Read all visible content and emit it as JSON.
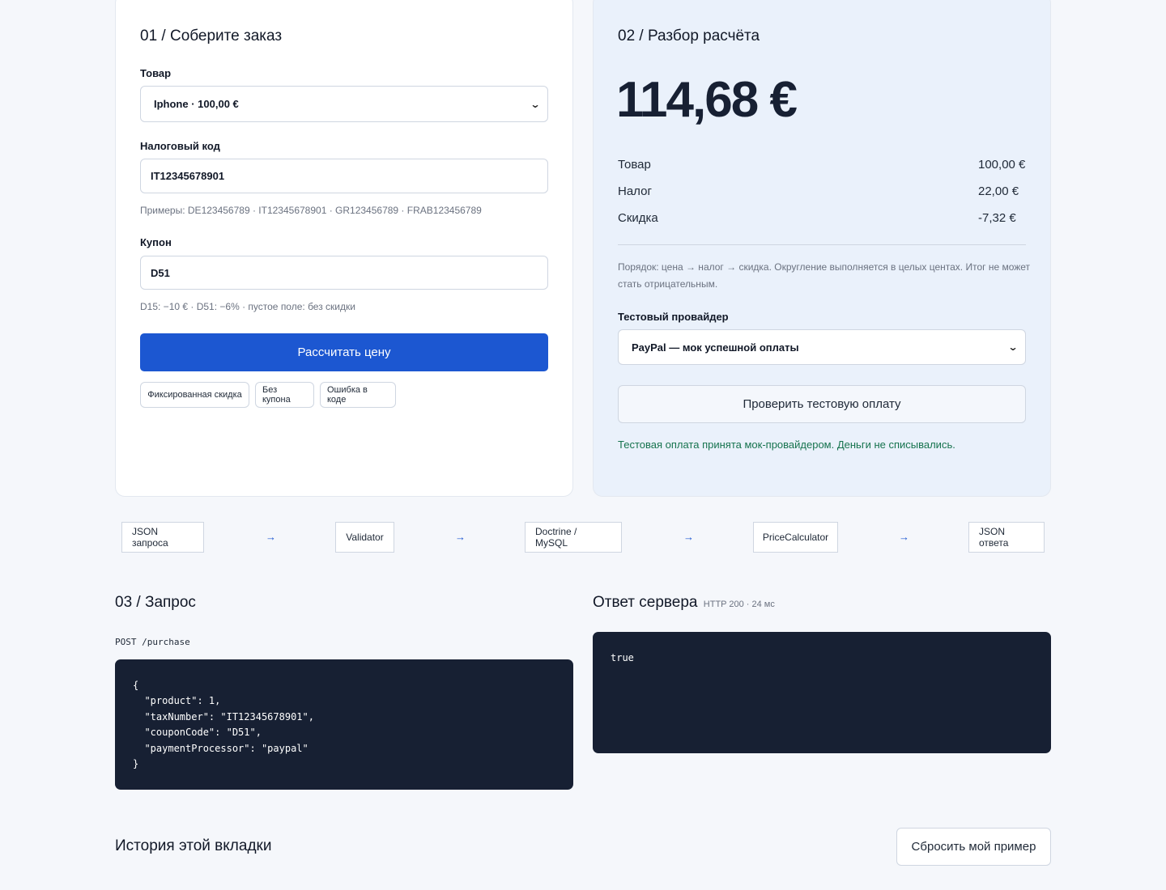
{
  "order": {
    "title": "01 / Соберите заказ",
    "product": {
      "label": "Товар",
      "value": "Iphone · 100,00 €"
    },
    "tax": {
      "label": "Налоговый код",
      "value": "IT12345678901",
      "hint": "Примеры: DE123456789 · IT12345678901 · GR123456789 · FRAB123456789"
    },
    "coupon": {
      "label": "Купон",
      "value": "D51",
      "hint": "D15: −10 € · D51: −6% · пустое поле: без скидки"
    },
    "calculate_label": "Рассчитать цену",
    "presets": [
      "Фиксированная скидка",
      "Без купона",
      "Ошибка в коде"
    ]
  },
  "breakdown": {
    "title": "02 / Разбор расчёта",
    "total": "114,68 €",
    "rows": [
      {
        "label": "Товар",
        "value": "100,00 €"
      },
      {
        "label": "Налог",
        "value": "22,00 €"
      },
      {
        "label": "Скидка",
        "value": "-7,32 €"
      }
    ],
    "note": "Порядок: цена → налог → скидка. Округление выполняется в целых центах. Итог не может стать отрицательным.",
    "provider": {
      "label": "Тестовый провайдер",
      "value": "PayPal — мок успешной оплаты"
    },
    "check_label": "Проверить тестовую оплату",
    "success_message": "Тестовая оплата принята мок-провайдером. Деньги не списывались."
  },
  "flow": {
    "nodes": [
      "JSON запроса",
      "Validator",
      "Doctrine / MySQL",
      "PriceCalculator",
      "JSON ответа"
    ],
    "arrow": "→"
  },
  "request": {
    "title": "03 / Запрос",
    "endpoint": "POST /purchase",
    "code_lines": [
      "{",
      "  \"product\": 1,",
      "  \"taxNumber\": \"IT12345678901\",",
      "  \"couponCode\": \"D51\",",
      "  \"paymentProcessor\": \"paypal\"",
      "}"
    ]
  },
  "response": {
    "title": "Ответ сервера",
    "meta": "HTTP 200 · 24 мс",
    "body": "true"
  },
  "history": {
    "title": "История этой вкладки",
    "reset_label": "Сбросить мой пример"
  },
  "colors": {
    "accent": "#1c57d1",
    "success": "#16734e",
    "code_background": "#172033",
    "breakdown_background": "#eaf1fb"
  }
}
